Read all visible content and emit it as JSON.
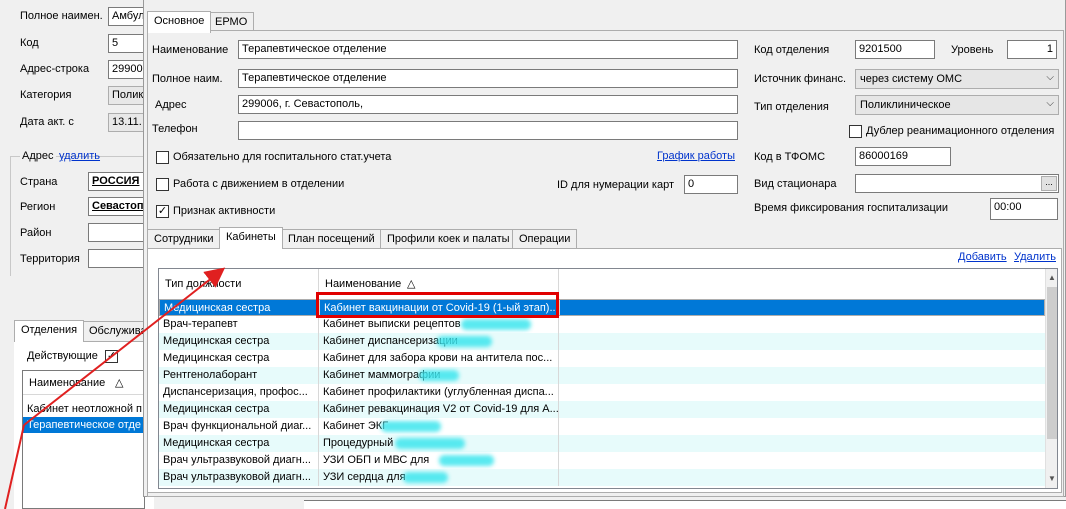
{
  "left": {
    "fields": [
      {
        "label": "Полное наимен.",
        "value": "Амбул"
      },
      {
        "label": "Код",
        "value": "5"
      },
      {
        "label": "Адрес-строка",
        "value": "29900"
      },
      {
        "label": "Категория",
        "value": "Полик"
      },
      {
        "label": "Дата акт. с",
        "value": "13.11."
      }
    ],
    "address_label": "Адрес",
    "address_delete": "удалить",
    "address_fields": [
      {
        "label": "Страна",
        "value": "РОССИЯ"
      },
      {
        "label": "Регион",
        "value": "Севастоп"
      },
      {
        "label": "Район",
        "value": ""
      },
      {
        "label": "Территория",
        "value": ""
      }
    ],
    "tabs": [
      "Отделения",
      "Обслужива"
    ],
    "active_label": "Действующие",
    "list_header": "Наименование",
    "list_items": [
      "Кабинет неотложной п",
      "Терапевтическое отде"
    ]
  },
  "dialog": {
    "tabs": [
      "Основное",
      "ЕРМО"
    ],
    "name_label": "Наименование",
    "name_value": "Терапевтическое отделение",
    "fullname_label": "Полное наим.",
    "fullname_value": "Терапевтическое отделение",
    "address_label": "Адрес",
    "address_value": "299006, г. Севастополь,",
    "phone_label": "Телефон",
    "phone_value": "",
    "code_label": "Код отделения",
    "code_value": "9201500",
    "level_label": "Уровень",
    "level_value": "1",
    "finance_label": "Источник финанс.",
    "finance_value": "через систему ОМС",
    "dept_type_label": "Тип отделения",
    "dept_type_value": "Поликлиническое",
    "reanim_label": "Дублер реанимационного отделения",
    "gosp_label": "Обязательно для госпитального стат.учета",
    "schedule_link": "График работы",
    "tfoms_label": "Код в ТФОМС",
    "tfoms_value": "86000169",
    "movement_label": "Работа с движением в отделении",
    "card_id_label": "ID для нумерации карт",
    "card_id_value": "0",
    "stationary_label": "Вид стационара",
    "stationary_btn": "...",
    "active_label": "Признак активности",
    "hosp_time_label": "Время фиксирования госпитализации",
    "hosp_time_value": "00:00",
    "subtabs": [
      "Сотрудники",
      "Кабинеты",
      "План посещений",
      "Профили коек и палаты",
      "Операции"
    ],
    "add_link": "Добавить",
    "delete_link": "Удалить",
    "grid": {
      "columns": [
        "Тип должности",
        "Наименование"
      ],
      "rows": [
        [
          "Медицинская сестра",
          "Кабинет вакцинации от Covid-19 (1-ый этап)..."
        ],
        [
          "Врач-терапевт",
          "Кабинет выписки рецептов"
        ],
        [
          "Медицинская сестра",
          "Кабинет диспансеризации"
        ],
        [
          "Медицинская сестра",
          "Кабинет для забора крови на антитела пос..."
        ],
        [
          "Рентгенолаборант",
          "Кабинет маммографии"
        ],
        [
          "Диспансеризация, профос...",
          "Кабинет профилактики (углубленная диспа..."
        ],
        [
          "Медицинская сестра",
          "Кабинет ревакцинация V2 от Covid-19 для А..."
        ],
        [
          "Врач функциональной диаг...",
          "Кабинет ЭКГ"
        ],
        [
          "Медицинская сестра",
          "Процедурный"
        ],
        [
          "Врач ультразвуковой диагн...",
          "УЗИ ОБП и МВС для"
        ],
        [
          "Врач ультразвуковой диагн...",
          "УЗИ сердца для"
        ]
      ]
    }
  },
  "colors": {
    "selection": "#0078d7",
    "highlight_box": "#e00000",
    "arrow": "#e02020",
    "row_alt": "#e7fbfb"
  }
}
